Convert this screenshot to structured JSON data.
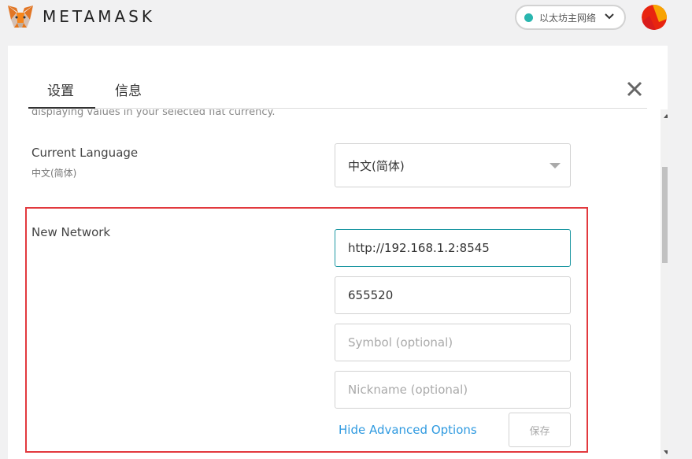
{
  "app": {
    "brand": "METAMASK",
    "network_label": "以太坊主网络",
    "network_dot_color": "#29b6af"
  },
  "tabs": [
    {
      "label": "设置"
    },
    {
      "label": "信息"
    }
  ],
  "settings": {
    "cutoff_text": "displaying values in your selected fiat currency.",
    "language": {
      "label": "Current Language",
      "current": "中文(简体)",
      "selected": "中文(简体)"
    },
    "new_network": {
      "label": "New Network",
      "rpc_url_value": "http://192.168.1.2:8545",
      "chain_id_value": "655520",
      "symbol_placeholder": "Symbol (optional)",
      "nickname_placeholder": "Nickname (optional)",
      "advanced_link": "Hide Advanced Options",
      "save_label": "保存"
    }
  },
  "colors": {
    "highlight_frame": "#e2393e",
    "link": "#2f9ae0",
    "focus_border": "#1e98a3"
  }
}
